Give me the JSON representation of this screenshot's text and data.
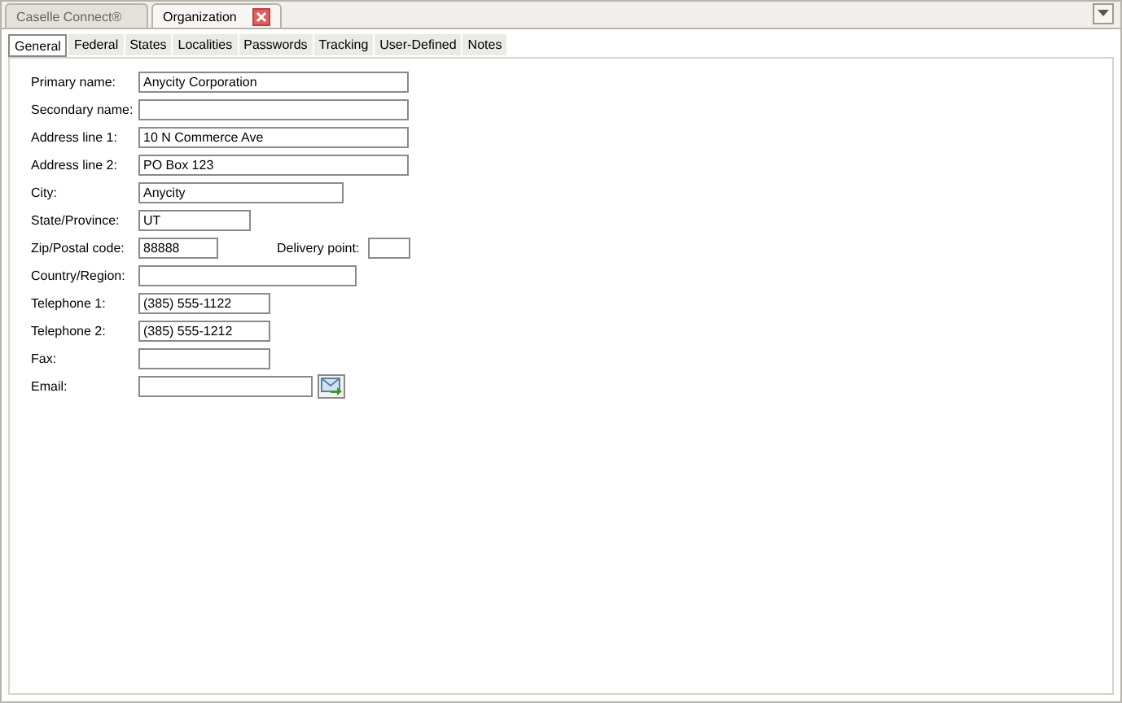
{
  "doc_tabs": [
    {
      "label": "Caselle Connect®",
      "selected": false,
      "closable": false
    },
    {
      "label": "Organization",
      "selected": true,
      "closable": true
    }
  ],
  "tabs": [
    {
      "label": "General",
      "selected": true
    },
    {
      "label": "Federal",
      "selected": false
    },
    {
      "label": "States",
      "selected": false
    },
    {
      "label": "Localities",
      "selected": false
    },
    {
      "label": "Passwords",
      "selected": false
    },
    {
      "label": "Tracking",
      "selected": false
    },
    {
      "label": "User-Defined",
      "selected": false
    },
    {
      "label": "Notes",
      "selected": false
    }
  ],
  "fields": [
    {
      "label": "Primary name:",
      "value": "Anycity Corporation",
      "send_button": false
    },
    {
      "label": "Secondary name:",
      "send_button": false
    },
    {
      "label": "Address line 1:",
      "value": "10 N Commerce Ave",
      "send_button": false
    },
    {
      "label": "Address line 2:",
      "value": "PO Box 123",
      "send_button": false
    },
    {
      "label": "City:",
      "value": "Anycity",
      "send_button": false
    },
    {
      "label": "State/Province:",
      "value": "UT",
      "send_button": false
    },
    {
      "label": "Zip/Postal code:",
      "value": "88888",
      "extra": {
        "label": "Delivery point:"
      },
      "send_button": false
    },
    {
      "label": "Country/Region:",
      "send_button": false
    },
    {
      "label": "Telephone 1:",
      "value": "(385) 555-1122",
      "send_button": false
    },
    {
      "label": "Telephone 2:",
      "value": "(385) 555-1212",
      "send_button": false
    },
    {
      "label": "Fax:",
      "send_button": false
    },
    {
      "label": "Email:",
      "send_button": true
    }
  ]
}
